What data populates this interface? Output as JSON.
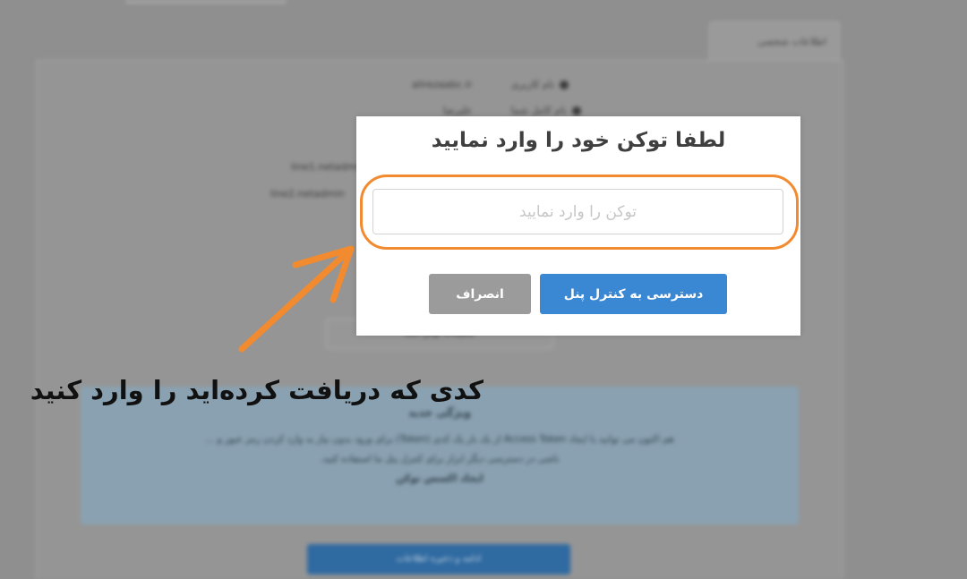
{
  "background": {
    "tab_label": "اطلاعات شخصی",
    "rows": [
      {
        "label": "نام کاربری",
        "value": "alirezaabc.ir"
      },
      {
        "label": "نام کامل شما",
        "value": "علیرضا"
      },
      {
        "label": "",
        "value": "line1.netadmin"
      },
      {
        "label": "",
        "value": "line2.netadmin"
      }
    ],
    "button_group_label": "تنظیمات توکن شما",
    "info_box": {
      "title": "ویژگی جدید",
      "paragraph_1": "هم اکنون می توانید با ایجاد Access Token از یک بار یک کدی (Token) برای ورود بدون نیاز به وارد کردن رمز عبور و ...",
      "paragraph_2": "ناشی در دسترسی دیگر ابزار برای کنترل پنل ما استفاده کنید.",
      "link_text": "ایجاد اکسس توکن"
    },
    "bottom_button_label": "ادامه و ذخیره اطلاعات"
  },
  "modal": {
    "title": "لطفا توکن خود را وارد نمایید",
    "input_value": "",
    "input_placeholder": "توکن را وارد نمایید",
    "access_button_label": "دسترسی به کنترل پنل",
    "cancel_button_label": "انصراف"
  },
  "annotation": {
    "caption": "کدی که دریافت کرده‌اید را وارد کنید",
    "color": "#f28a2f"
  },
  "colors": {
    "primary_button": "#3a87d4",
    "cancel_button": "#9b9b9b",
    "overlay": "#8f8f8f"
  }
}
